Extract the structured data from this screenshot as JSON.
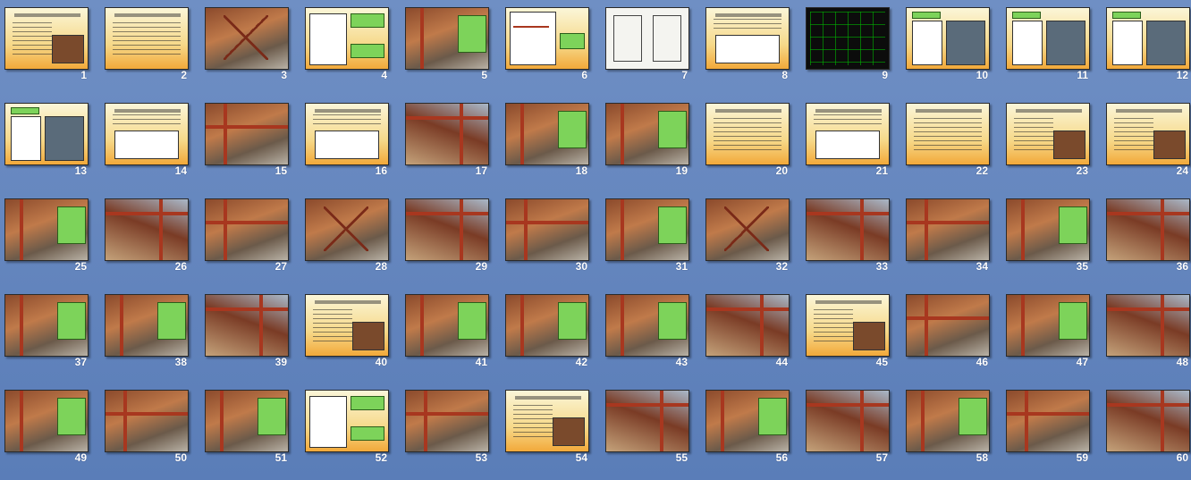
{
  "view": "slide-sorter",
  "slides": [
    {
      "number": "1",
      "style": "doc-photo"
    },
    {
      "number": "2",
      "style": "doc"
    },
    {
      "number": "3",
      "style": "photo-x"
    },
    {
      "number": "4",
      "style": "diagram-green"
    },
    {
      "number": "5",
      "style": "photo-green"
    },
    {
      "number": "6",
      "style": "diagram-red"
    },
    {
      "number": "7",
      "style": "diagram-white"
    },
    {
      "number": "8",
      "style": "doc-diagram"
    },
    {
      "number": "9",
      "style": "cad-dark"
    },
    {
      "number": "10",
      "style": "diagram-photo"
    },
    {
      "number": "11",
      "style": "diagram-photo"
    },
    {
      "number": "12",
      "style": "diagram-photo"
    },
    {
      "number": "13",
      "style": "diagram-photo"
    },
    {
      "number": "14",
      "style": "doc-diagram"
    },
    {
      "number": "15",
      "style": "photo"
    },
    {
      "number": "16",
      "style": "doc-diagram"
    },
    {
      "number": "17",
      "style": "photo2"
    },
    {
      "number": "18",
      "style": "photo-green"
    },
    {
      "number": "19",
      "style": "photo-green"
    },
    {
      "number": "20",
      "style": "doc"
    },
    {
      "number": "21",
      "style": "doc-diagram"
    },
    {
      "number": "22",
      "style": "doc"
    },
    {
      "number": "23",
      "style": "doc-photo"
    },
    {
      "number": "24",
      "style": "doc-photo"
    },
    {
      "number": "25",
      "style": "photo-green"
    },
    {
      "number": "26",
      "style": "photo2"
    },
    {
      "number": "27",
      "style": "photo"
    },
    {
      "number": "28",
      "style": "photo-x"
    },
    {
      "number": "29",
      "style": "photo2"
    },
    {
      "number": "30",
      "style": "photo"
    },
    {
      "number": "31",
      "style": "photo-green"
    },
    {
      "number": "32",
      "style": "photo-x"
    },
    {
      "number": "33",
      "style": "photo2"
    },
    {
      "number": "34",
      "style": "photo"
    },
    {
      "number": "35",
      "style": "photo-green"
    },
    {
      "number": "36",
      "style": "photo2"
    },
    {
      "number": "37",
      "style": "photo-green"
    },
    {
      "number": "38",
      "style": "photo-green"
    },
    {
      "number": "39",
      "style": "photo2"
    },
    {
      "number": "40",
      "style": "doc-photo"
    },
    {
      "number": "41",
      "style": "photo-green"
    },
    {
      "number": "42",
      "style": "photo-green"
    },
    {
      "number": "43",
      "style": "photo-green"
    },
    {
      "number": "44",
      "style": "photo2"
    },
    {
      "number": "45",
      "style": "doc-photo"
    },
    {
      "number": "46",
      "style": "photo"
    },
    {
      "number": "47",
      "style": "photo-green"
    },
    {
      "number": "48",
      "style": "photo2"
    },
    {
      "number": "49",
      "style": "photo-green"
    },
    {
      "number": "50",
      "style": "photo"
    },
    {
      "number": "51",
      "style": "photo-green"
    },
    {
      "number": "52",
      "style": "diagram-green"
    },
    {
      "number": "53",
      "style": "photo"
    },
    {
      "number": "54",
      "style": "doc-photo"
    },
    {
      "number": "55",
      "style": "photo2"
    },
    {
      "number": "56",
      "style": "photo-green"
    },
    {
      "number": "57",
      "style": "photo2"
    },
    {
      "number": "58",
      "style": "photo-green"
    },
    {
      "number": "59",
      "style": "photo"
    },
    {
      "number": "60",
      "style": "photo2"
    }
  ],
  "colors": {
    "background": "#6a8bc2",
    "slide_number": "#ffffff",
    "accent_green": "#7dd35a",
    "steel_red": "#a8371f"
  }
}
